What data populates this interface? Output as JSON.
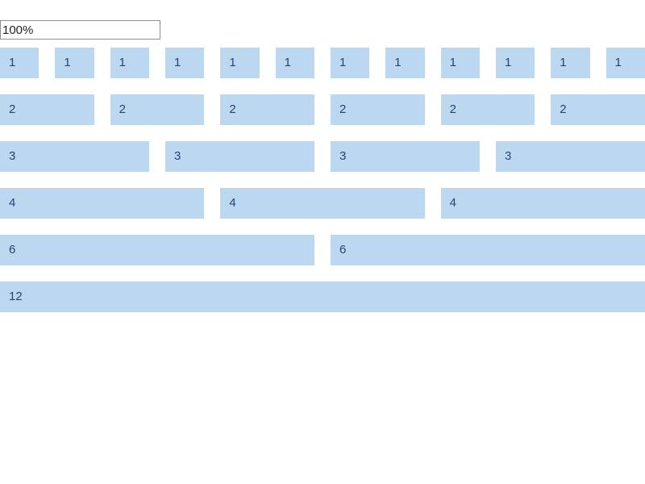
{
  "width_input": {
    "value": "100%"
  },
  "colors": {
    "cell_background": "#bcd8f1",
    "cell_text": "#2c3f73"
  },
  "grid": {
    "columns": 12,
    "rows": [
      {
        "span": 1,
        "cells": [
          "1",
          "1",
          "1",
          "1",
          "1",
          "1",
          "1",
          "1",
          "1",
          "1",
          "1",
          "1"
        ]
      },
      {
        "span": 2,
        "cells": [
          "2",
          "2",
          "2",
          "2",
          "2",
          "2"
        ]
      },
      {
        "span": 3,
        "cells": [
          "3",
          "3",
          "3",
          "3"
        ]
      },
      {
        "span": 4,
        "cells": [
          "4",
          "4",
          "4"
        ]
      },
      {
        "span": 6,
        "cells": [
          "6",
          "6"
        ]
      },
      {
        "span": 12,
        "cells": [
          "12"
        ]
      }
    ]
  }
}
